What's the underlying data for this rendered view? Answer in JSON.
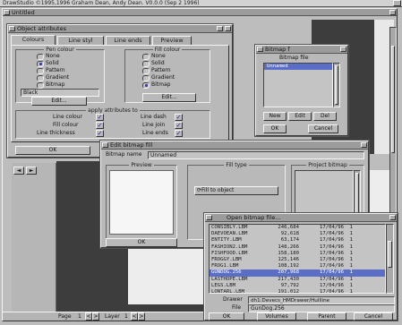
{
  "screen": {
    "title": "DrawStudio  ©1995,1996 Graham Dean, Andy Dean. V0.0.0 (Sep  2 1996)",
    "sub_title": "Untitled",
    "status": {
      "page_label": "Page",
      "page_value": "1",
      "layer_label": "Layer",
      "layer_value": "1"
    }
  },
  "object_attributes": {
    "title": "Object attributes",
    "tabs": [
      "Colours",
      "Line styl",
      "Line ends",
      "Preview"
    ],
    "pen_group": {
      "title": "Pen colour",
      "options": [
        "None",
        "Solid",
        "Pattern",
        "Gradient",
        "Bitmap"
      ],
      "selected": 1,
      "colour_value": "Black",
      "edit_label": "Edit..."
    },
    "fill_group": {
      "title": "Fill colour",
      "options": [
        "None",
        "Solid",
        "Pattern",
        "Gradient",
        "Bitmap"
      ],
      "selected": 4,
      "edit_label": "Edit..."
    },
    "apply_group": {
      "title": "apply attributes to",
      "left": [
        "Line colour",
        "Fill colour",
        "Line thickness"
      ],
      "right": [
        "Line dash",
        "Line join",
        "Line ends"
      ]
    },
    "ok_label": "OK"
  },
  "bitmap_files": {
    "title": "Bitmap f",
    "header": "Bitmap file",
    "items": [
      "Unnamed"
    ],
    "buttons": [
      "New",
      "Edit",
      "Del"
    ],
    "ok_label": "OK",
    "cancel_label": "Cancel"
  },
  "edit_bitmap_fill": {
    "title": "Edit bitmap fill",
    "name_label": "Bitmap name",
    "name_value": "Unnamed",
    "preview_label": "Preview",
    "fill_type_label": "Fill type",
    "fill_option": "Fill to object",
    "project_label": "Project bitmap",
    "ok_label": "OK"
  },
  "open_bitmap_file": {
    "title": "Open bitmap file...",
    "files": [
      {
        "name": "CONSIBLY.LBM",
        "size": "246,684",
        "date": "17/04/96",
        "time": "1"
      },
      {
        "name": "DAEVOEAN.LBM",
        "size": "92,618",
        "date": "17/04/96",
        "time": "1"
      },
      {
        "name": "ENTITY.LBM",
        "size": "63,174",
        "date": "17/04/96",
        "time": "1"
      },
      {
        "name": "FASHION2.LBM",
        "size": "148,266",
        "date": "17/04/96",
        "time": "1"
      },
      {
        "name": "FISHFOOD.LBM",
        "size": "158,180",
        "date": "17/04/96",
        "time": "1"
      },
      {
        "name": "FROGGY.LBM",
        "size": "125,146",
        "date": "17/04/96",
        "time": "1"
      },
      {
        "name": "FROG1.LBM",
        "size": "108,192",
        "date": "17/04/96",
        "time": "1"
      },
      {
        "name": "GUNDOG.256",
        "size": "207,968",
        "date": "17/04/96",
        "time": "1"
      },
      {
        "name": "LASTHOPE.LBM",
        "size": "217,430",
        "date": "17/04/96",
        "time": "1"
      },
      {
        "name": "LEGS.LBM",
        "size": "97,792",
        "date": "17/04/96",
        "time": "1"
      },
      {
        "name": "LONTARL.LBM",
        "size": "191,012",
        "date": "17/04/96",
        "time": "1"
      },
      {
        "name": "MERLIFE.LBM",
        "size": "199,434",
        "date": "17/04/96",
        "time": "1"
      }
    ],
    "selected_index": 7,
    "drawer_label": "Drawer",
    "drawer_value": "dh1:Devecs_HMDrawer/Hullline",
    "file_label": "File",
    "file_value": "GunDog.256",
    "ok_label": "OK",
    "volumes_label": "Volumes",
    "parent_label": "Parent",
    "cancel_label": "Cancel"
  },
  "colors": {
    "desktop": "#bdbdbd",
    "selection": "#5a6ec8",
    "document_dark": "#3d3d3d"
  }
}
